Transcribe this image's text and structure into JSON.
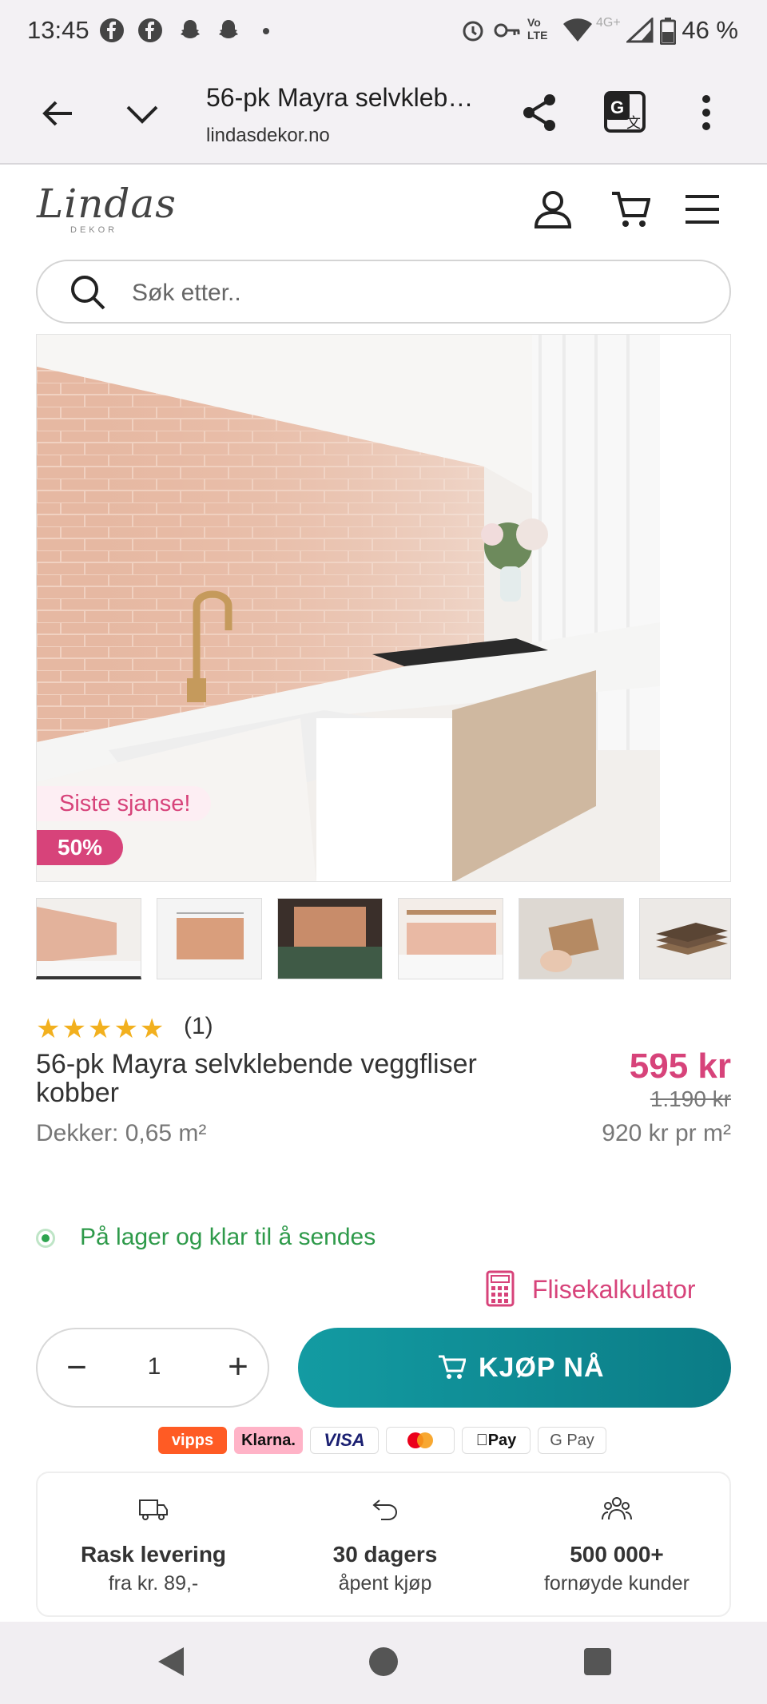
{
  "status_bar": {
    "time": "13:45",
    "battery": "46 %",
    "icons": [
      "facebook-icon",
      "facebook-icon",
      "snapchat-icon",
      "snapchat-icon",
      "dot-icon",
      "alarm-icon",
      "key-icon",
      "volte-icon",
      "wifi-icon",
      "signal-icon",
      "battery-icon"
    ],
    "lte_label": "Vo LTE",
    "net_label": "4G+"
  },
  "browser": {
    "title": "56-pk Mayra selvkleb…",
    "domain": "lindasdekor.no"
  },
  "site": {
    "logo": "Lindas",
    "logo_sub": "DEKOR"
  },
  "search": {
    "placeholder": "Søk etter.."
  },
  "gallery": {
    "badge_sale": "Siste sjanse!",
    "badge_discount": "50%",
    "thumbnails": [
      "thumb-1",
      "thumb-2",
      "thumb-3",
      "thumb-4",
      "thumb-5",
      "thumb-6"
    ]
  },
  "product": {
    "rating_stars": "★★★★★",
    "rating_count": "(1)",
    "name": "56-pk Mayra selvklebende veggfliser kobber",
    "coverage": "Dekker: 0,65 m²",
    "price": "595 kr",
    "old_price": "1.190 kr",
    "price_per": "920 kr pr m²",
    "stock": "På lager og klar til å sendes",
    "calculator": "Flisekalkulator"
  },
  "purchase": {
    "quantity": "1",
    "minus": "−",
    "plus": "+",
    "buy_label": "KJØP NÅ"
  },
  "payments": [
    "vipps",
    "Klarna.",
    "VISA",
    "",
    "Pay",
    "G Pay"
  ],
  "benefits": [
    {
      "title": "Rask levering",
      "sub": "fra kr. 89,-"
    },
    {
      "title": "30 dagers",
      "sub": "åpent kjøp"
    },
    {
      "title": "500 000+",
      "sub": "fornøyde kunder"
    }
  ],
  "colors": {
    "accent_pink": "#d7437a",
    "teal_button": "#0f8f98",
    "stock_green": "#2e9a4a",
    "star_yellow": "#f2b01e"
  }
}
